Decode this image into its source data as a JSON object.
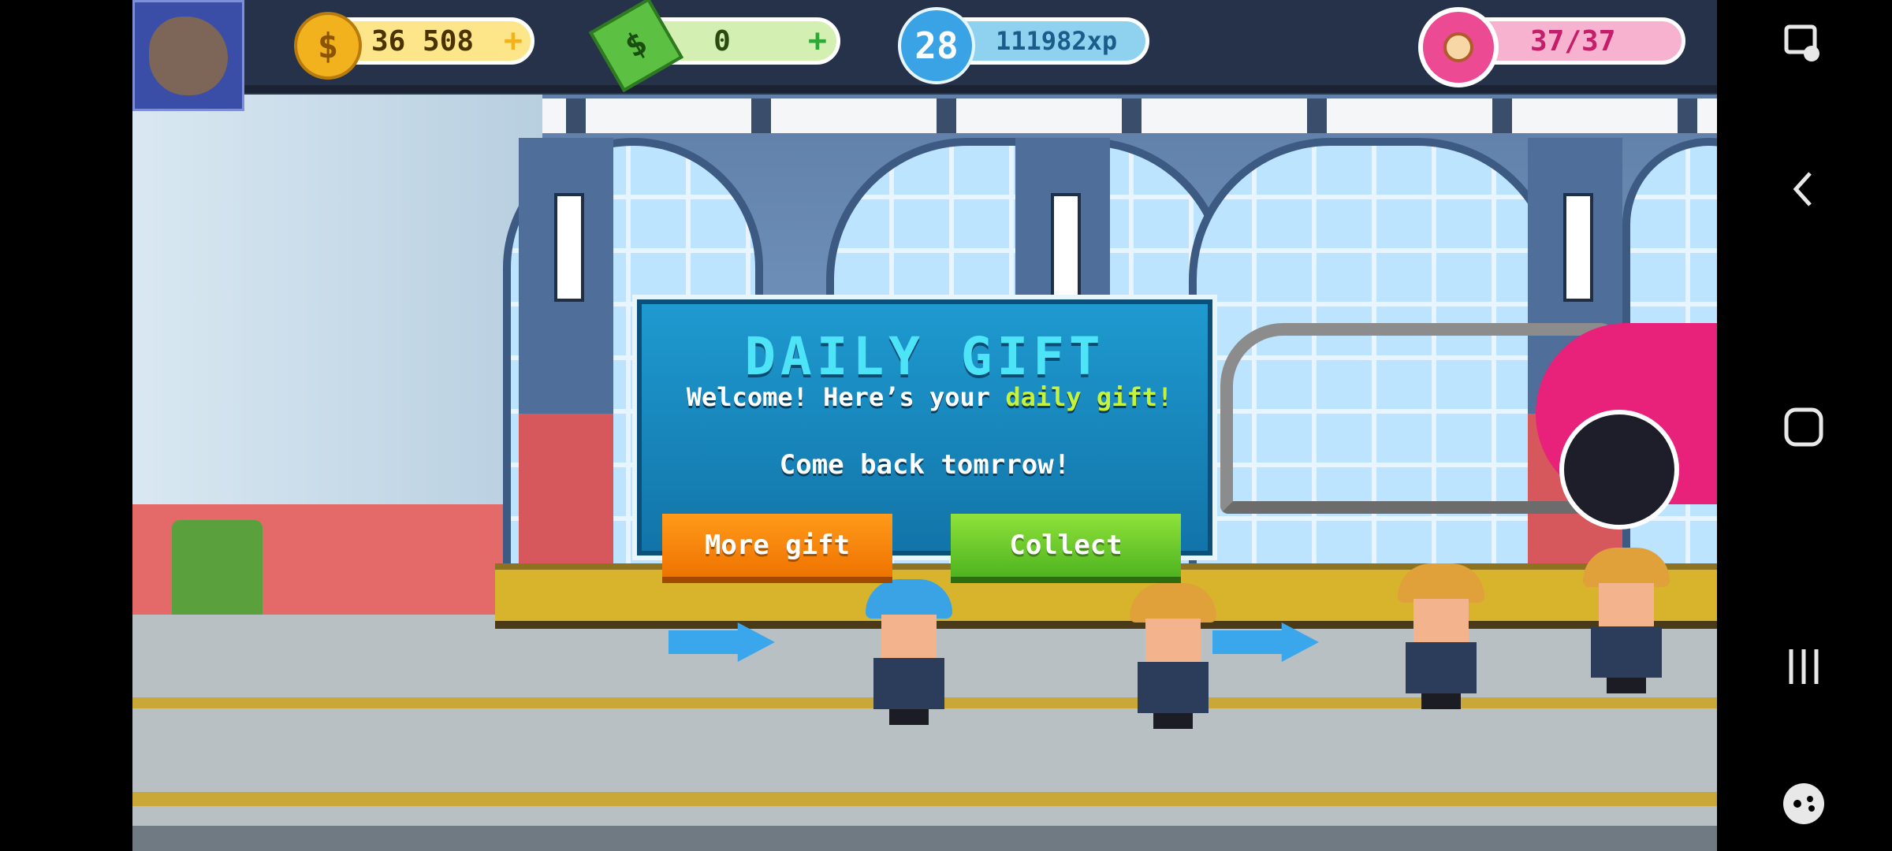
{
  "hud": {
    "coins": "36 508",
    "coins_plus": "+",
    "coin_symbol": "$",
    "cash": "0",
    "cash_plus": "+",
    "cash_symbol": "$",
    "level": "28",
    "xp": "111982xp",
    "energy": "37/37"
  },
  "dialog": {
    "title": "DAILY GIFT",
    "message_prefix": "Welcome! Here’s your ",
    "message_highlight": "daily gift!",
    "message_2": "Come back tomrrow!",
    "more_button": "More gift",
    "collect_button": "Collect"
  },
  "icons": {
    "coin": "coin-icon",
    "cash": "cash-icon",
    "xp": "xp-badge-icon",
    "energy": "donut-icon",
    "nav": [
      "screenshot-tool-icon",
      "back-icon",
      "home-icon",
      "recents-icon",
      "game-tools-icon"
    ]
  },
  "colors": {
    "dialog_bg": "#1e9ad0",
    "title": "#4de4f8",
    "highlight": "#c6f23a",
    "more_button": "#ff9a1a",
    "collect_button": "#8fe23a"
  }
}
